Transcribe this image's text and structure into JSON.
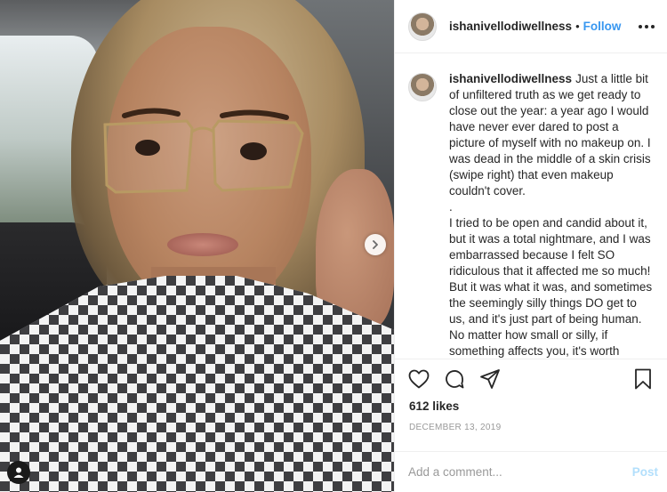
{
  "post": {
    "username": "ishanivellodiwellness",
    "follow_label": "Follow",
    "separator": "•",
    "caption_paragraphs": [
      "Just a little bit of unfiltered truth as we get ready to close out the year: a year ago I would have never ever dared to post a picture of myself with no makeup on. I was dead in the middle of a skin crisis (swipe right) that even makeup couldn't cover.",
      ".",
      "I tried to be open and candid about it, but it was a total nightmare, and I was embarrassed because I felt SO ridiculous that it affected me so much! But it was what it was, and sometimes the seemingly silly things DO get to us, and it's just part of being human. No matter how small or silly, if something affects you, it's worth dealing with!"
    ],
    "likes": "612 likes",
    "date": "DECEMBER 13, 2019",
    "comment_placeholder": "Add a comment...",
    "post_label": "Post"
  },
  "icons": {
    "more": "more-options-icon",
    "like": "heart-icon",
    "comment": "comment-icon",
    "share": "share-icon",
    "save": "bookmark-icon",
    "next": "chevron-right-icon",
    "tag": "user-tag-icon"
  },
  "colors": {
    "link_blue": "#3897f0",
    "post_disabled": "#b2dffc",
    "text": "#262626",
    "muted": "#999999",
    "border": "#efefef"
  }
}
